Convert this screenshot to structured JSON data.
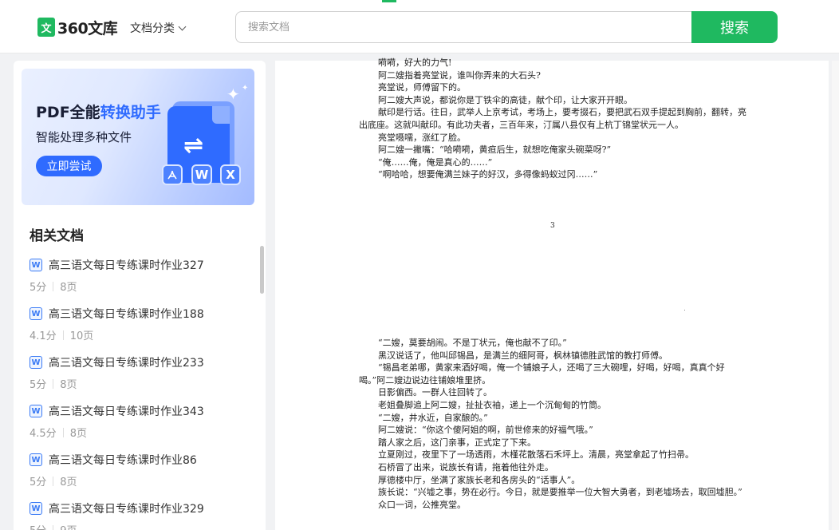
{
  "header": {
    "logo_mark": "文",
    "logo_text": "360文库",
    "category_label": "文档分类",
    "search_placeholder": "搜索文档",
    "search_button": "搜索"
  },
  "promo": {
    "title_prefix": "PDF全能",
    "title_highlight": "转换助手",
    "subtitle": "智能处理多种文件",
    "button": "立即尝试",
    "badges": [
      "W",
      "X"
    ]
  },
  "related": {
    "title": "相关文档",
    "items": [
      {
        "name": "高三语文每日专练课时作业327",
        "score": "5分",
        "pages": "8页"
      },
      {
        "name": "高三语文每日专练课时作业188",
        "score": "4.1分",
        "pages": "10页"
      },
      {
        "name": "高三语文每日专练课时作业233",
        "score": "5分",
        "pages": "8页"
      },
      {
        "name": "高三语文每日专练课时作业343",
        "score": "4.5分",
        "pages": "8页"
      },
      {
        "name": "高三语文每日专练课时作业86",
        "score": "5分",
        "pages": "8页"
      },
      {
        "name": "高三语文每日专练课时作业329",
        "score": "5分",
        "pages": "9页"
      }
    ]
  },
  "document": {
    "page_number": "3",
    "block1": [
      "嗬嗬，好大的力气!",
      "阿二嫂指着亮堂说，谁叫你弄来的大石头?",
      "亮堂说，师傅留下的。",
      "阿二嫂大声说，都说你是丁铁伞的高徒，献个印，让大家开开眼。",
      "献印是行话。往日，武举人上京考试，考场上，要考掇石，要把武石双手提起到胸前，翻转，亮出底座。这就叫献印。有此功夫者，三百年来，汀属八县仅有上杭丁锦堂状元一人。",
      "亮堂嗫嚅，涨红了脸。",
      "阿二嫂一撇嘴：“哈嗬嗬，黄疸后生，就想吃俺家头碗菜呀?”",
      "“俺……俺，俺是真心的……”",
      "“啊哈哈，想要俺满兰妹子的好汉，多得像蚂蚁过冈……”"
    ],
    "block2": [
      "“二嫂，莫要胡闹。不是丁状元，俺也献不了印。”",
      "黑汉说话了，他叫邱锡昌，是满兰的细阿哥，枫林镇德胜武馆的教打师傅。",
      "“锡昌老弟哪，黄家来酒好喝，俺一个铺娘子人，还喝了三大碗哩，好喝，好喝，真真个好喝。”阿二嫂边说边往铺娘堆里挤。",
      "日影偏西。一群人往回转了。",
      "老姐叠脚追上阿二嫂，扯扯衣袖，递上一个沉甸甸的竹筒。",
      "“二嫂，井水近，自家酿的。”",
      "阿二嫂说：“你这个傻阿姐的啊，前世修来的好福气哦。”",
      "踏人家之后，这门亲事，正式定了下来。",
      "立夏刚过，夜里下了一场透雨，木槿花散落石禾坪上。清晨，亮堂拿起了竹扫帚。",
      "石桥冒了出来，说族长有请，拖着他往外走。",
      "厚德楼中厅，坐满了家族长老和各房头的“话事人”。",
      "族长说：“兴墟之事，势在必行。今日，就是要推举一位大智大勇者，到老墟场去，取回墟胆。”",
      "众口一词，公推亮堂。"
    ]
  }
}
